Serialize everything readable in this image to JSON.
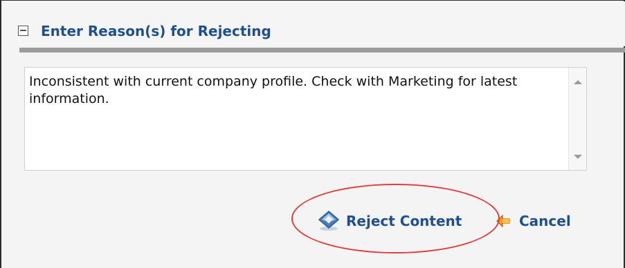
{
  "header": {
    "title": "Enter Reason(s) for Rejecting",
    "collapse_icon": "collapse-minus-icon"
  },
  "reason_field": {
    "value": "Inconsistent with current company profile. Check with Marketing for latest information."
  },
  "actions": {
    "reject_label": "Reject Content",
    "reject_icon": "reject-diamond-icon",
    "cancel_label": "Cancel",
    "cancel_icon": "cancel-arrow-icon"
  },
  "colors": {
    "title_blue": "#1f4f8f",
    "divider_gray": "#9c9c9c",
    "highlight_red": "#e03c3c",
    "panel_bg": "#f4f4f4"
  }
}
